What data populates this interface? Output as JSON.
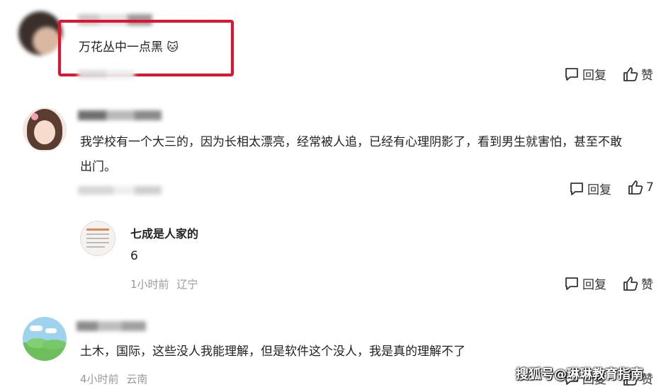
{
  "comments": [
    {
      "text": "万花丛中一点黑",
      "emoji": "🐱",
      "actions": {
        "reply": "回复",
        "like": "赞"
      }
    },
    {
      "text_line1": "我学校有一个大三的，因为长相太漂亮，经常被人追，已经有心理阴影了，看到男生就害怕，甚至不敢",
      "text_line2": "出门。",
      "actions": {
        "reply": "回复",
        "like": "7"
      }
    },
    {
      "username": "七成是人家的",
      "text": "6",
      "time": "1小时前",
      "location": "辽宁",
      "actions": {
        "reply": "回复",
        "like": "赞"
      }
    },
    {
      "text": "土木，国际，这些没人我能理解，但是软件这个没人，我是真的理解不了",
      "time": "4小时前",
      "location": "云南",
      "actions": {
        "reply": "回复",
        "like": "赞"
      }
    }
  ],
  "watermark": "搜狐号@琳琳教育指南",
  "colors": {
    "highlight": "#e8112d",
    "meta": "#999999",
    "text": "#222222"
  }
}
